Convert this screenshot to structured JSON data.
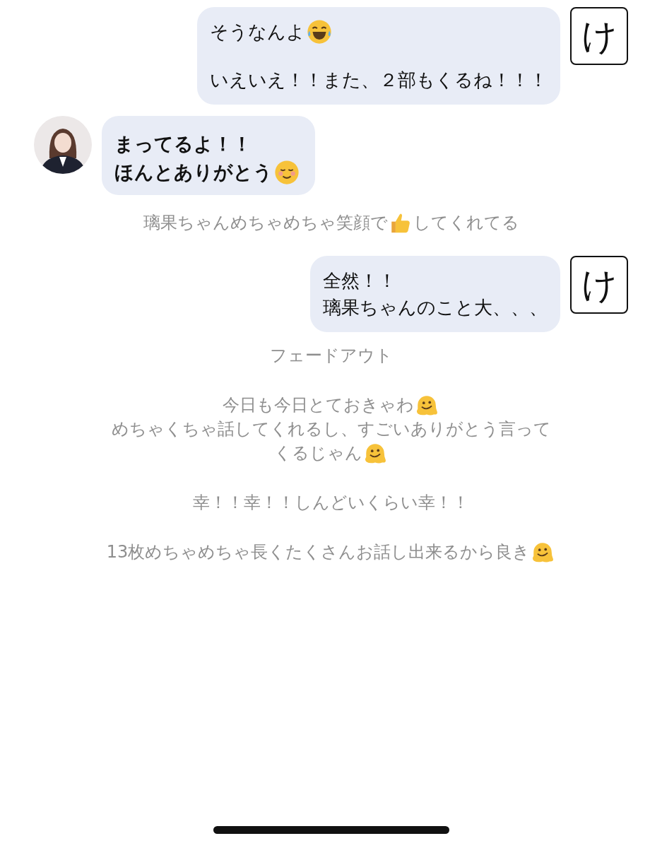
{
  "messages": [
    {
      "kind": "sent",
      "sender_label": "け",
      "paragraphs": [
        [
          [
            {
              "kind": "text",
              "text": "そうなんよ"
            },
            {
              "kind": "laugh"
            }
          ]
        ],
        [
          [
            {
              "kind": "text",
              "text": "いえいえ！！また、２部もくるね！！！"
            }
          ]
        ]
      ]
    },
    {
      "kind": "received",
      "avatar": {
        "kind": "picture"
      },
      "paragraphs": [
        [
          [
            {
              "kind": "text",
              "text": "まってるよ！！"
            }
          ],
          [
            {
              "kind": "text",
              "text": "ほんとありがとう"
            },
            {
              "kind": "smile"
            }
          ]
        ]
      ]
    },
    {
      "kind": "narration",
      "paragraphs": [
        [
          [
            {
              "kind": "text",
              "text": "璃果ちゃんめちゃめちゃ笑顔で"
            },
            {
              "kind": "thumb"
            },
            {
              "kind": "text",
              "text": "してくれてる"
            }
          ]
        ]
      ]
    },
    {
      "kind": "sent",
      "sender_label": "け",
      "paragraphs": [
        [
          [
            {
              "kind": "text",
              "text": "全然！！"
            }
          ],
          [
            {
              "kind": "text",
              "text": "璃果ちゃんのこと大、、、"
            }
          ]
        ]
      ]
    },
    {
      "kind": "narration",
      "paragraphs": [
        [
          [
            {
              "kind": "text",
              "text": "フェードアウト"
            }
          ]
        ],
        [
          [
            {
              "kind": "text",
              "text": "今日も今日とておきゃわ"
            },
            {
              "kind": "melt"
            }
          ],
          [
            {
              "kind": "text",
              "text": "めちゃくちゃ話してくれるし、すごいありがとう言って"
            }
          ],
          [
            {
              "kind": "text",
              "text": "くるじゃん"
            },
            {
              "kind": "melt"
            }
          ]
        ],
        [
          [
            {
              "kind": "text",
              "text": "幸！！幸！！しんどいくらい幸！！"
            }
          ]
        ],
        [
          [
            {
              "kind": "text",
              "text": "13枚めちゃめちゃ長くたくさんお話し出来るから良き"
            },
            {
              "kind": "melt"
            }
          ]
        ]
      ]
    }
  ]
}
